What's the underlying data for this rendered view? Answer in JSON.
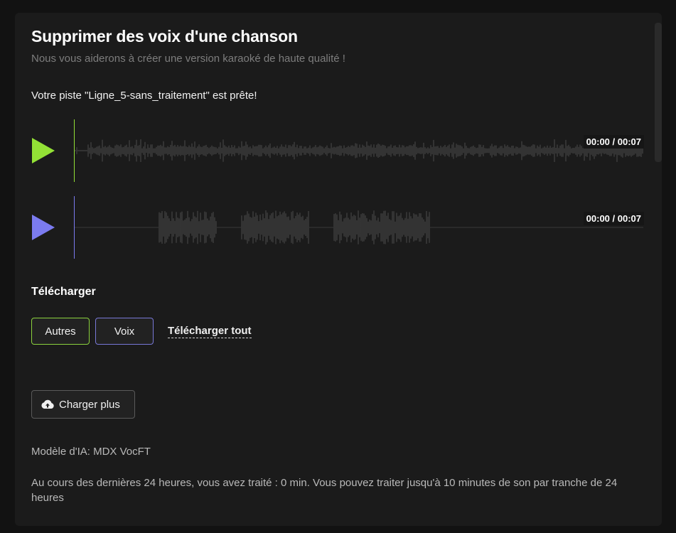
{
  "header": {
    "title": "Supprimer des voix d'une chanson",
    "subtitle": "Nous vous aiderons à créer une version karaoké de haute qualité !"
  },
  "status": {
    "ready_message": "Votre piste \"Ligne_5-sans_traitement\" est prête!"
  },
  "tracks": [
    {
      "name": "autres",
      "time": "00:00 / 00:07",
      "color": "#93e136",
      "play_icon": "play-icon"
    },
    {
      "name": "voix",
      "time": "00:00 / 00:07",
      "color": "#7b7bf0",
      "play_icon": "play-icon"
    }
  ],
  "download": {
    "title": "Télécharger",
    "autres_label": "Autres",
    "voix_label": "Voix",
    "all_label": "Télécharger tout"
  },
  "upload": {
    "label": "Charger plus",
    "icon": "cloud-upload-icon"
  },
  "info": {
    "model": "Modèle d'IA: MDX VocFT",
    "usage": "Au cours des dernières 24 heures, vous avez traité : 0 min. Vous pouvez traiter jusqu'à 10 minutes de son par tranche de 24 heures"
  },
  "colors": {
    "background": "#121212",
    "card": "#1b1b1b",
    "accent_green": "#93e136",
    "accent_purple": "#7b7bf0",
    "waveform": "#3a3a3a"
  }
}
